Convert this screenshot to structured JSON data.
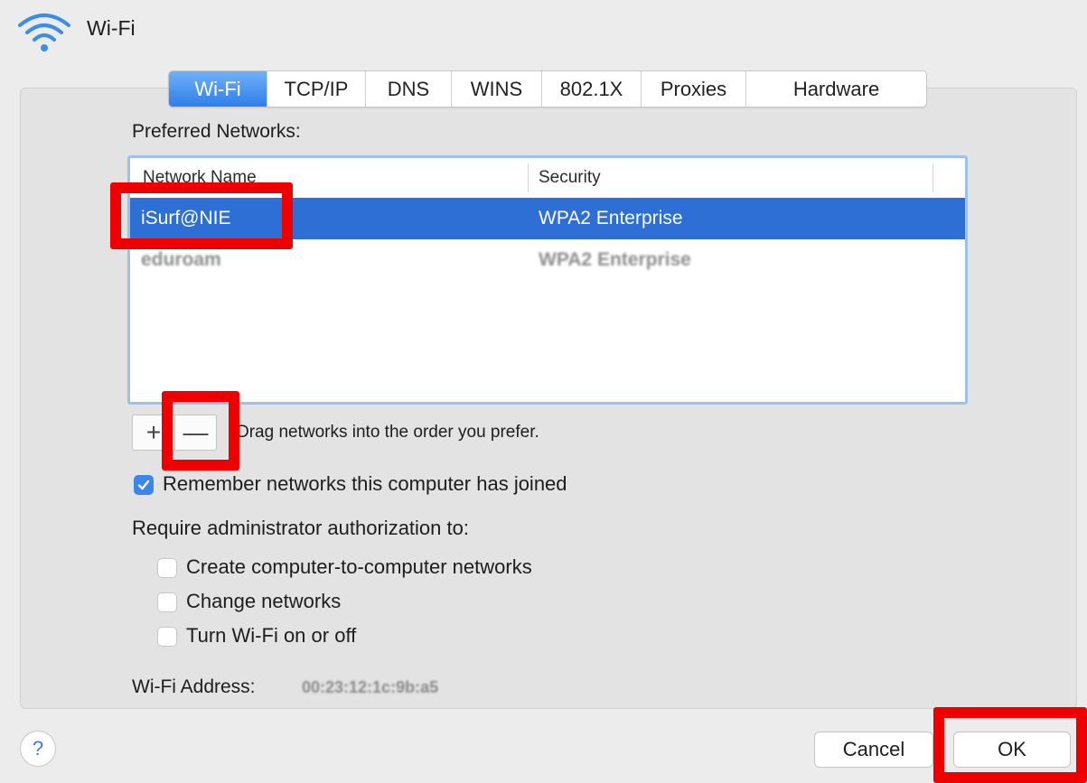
{
  "window": {
    "title": "Wi-Fi",
    "icon": "wifi-icon"
  },
  "tabs": [
    {
      "label": "Wi-Fi",
      "active": true
    },
    {
      "label": "TCP/IP",
      "active": false
    },
    {
      "label": "DNS",
      "active": false
    },
    {
      "label": "WINS",
      "active": false
    },
    {
      "label": "802.1X",
      "active": false
    },
    {
      "label": "Proxies",
      "active": false
    },
    {
      "label": "Hardware",
      "active": false
    }
  ],
  "preferred_networks": {
    "label": "Preferred Networks:",
    "columns": {
      "name": "Network Name",
      "security": "Security"
    },
    "rows": [
      {
        "name": "iSurf@NIE",
        "security": "WPA2 Enterprise",
        "selected": true
      },
      {
        "name": "eduroam",
        "security": "WPA2 Enterprise",
        "selected": false
      }
    ],
    "add_symbol": "+",
    "remove_symbol": "—",
    "drag_hint": "Drag networks into the order you prefer."
  },
  "remember": {
    "label": "Remember networks this computer has joined",
    "checked": true
  },
  "require_admin": {
    "label": "Require administrator authorization to:",
    "options": [
      {
        "label": "Create computer-to-computer networks",
        "checked": false
      },
      {
        "label": "Change networks",
        "checked": false
      },
      {
        "label": "Turn Wi-Fi on or off",
        "checked": false
      }
    ]
  },
  "wifi_address": {
    "label": "Wi-Fi Address:",
    "value": "00:23:12:1c:9b:a5"
  },
  "footer": {
    "help": "?",
    "cancel": "Cancel",
    "ok": "OK"
  },
  "colors": {
    "selection": "#2d6fd4",
    "accent": "#3b86ea",
    "highlight_box": "#ee0000"
  }
}
